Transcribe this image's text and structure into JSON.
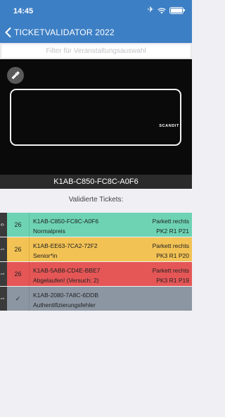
{
  "status_bar": {
    "time": "14:45",
    "icons": [
      "airplane-icon",
      "wifi-icon",
      "battery-icon"
    ]
  },
  "nav": {
    "title": "TICKETVALIDATOR 2022",
    "back_icon": "chevron-left-icon"
  },
  "filter": {
    "placeholder": "Filter für Veranstaltungsauswahl",
    "value": ""
  },
  "scanner": {
    "torch_icon": "flashlight-icon",
    "brand": "SCANDIT"
  },
  "scanned_code": "K1AB-C850-FC8C-A0F6",
  "list": {
    "header": "Validierte Tickets:",
    "tickets": [
      {
        "side": "0",
        "count": "26",
        "code": "K1AB-C850-FC8C-A0F6",
        "section": "Parkett rechts",
        "type": "Normalpreis",
        "seat": "PK2 R1 P21",
        "color": "#6dd3b3"
      },
      {
        "side": "1",
        "count": "26",
        "code": "K1AB-EE63-7CA2-72F2",
        "section": "Parkett rechts",
        "type": "Senior*in",
        "seat": "PK3 R1 P20",
        "color": "#f2c254"
      },
      {
        "side": "1",
        "count": "26",
        "code": "K1AB-5AB8-CD4E-BBE7",
        "section": "Parkett rechts",
        "type": "Abgelaufen! (Versuch: 2)",
        "seat": "PK3 R1 P19",
        "color": "#e55656"
      },
      {
        "side": "1",
        "count": "✓",
        "code": "K1AB-2080-7A8C-6DDB",
        "section": "",
        "type": "Authentifizierungsfehler",
        "seat": "",
        "color": "#8c96a3"
      }
    ]
  },
  "colors": {
    "brand_blue": "#3d7fc4",
    "scanner_bg": "#0a0a0a",
    "code_bar_bg": "#2b2b2b"
  }
}
